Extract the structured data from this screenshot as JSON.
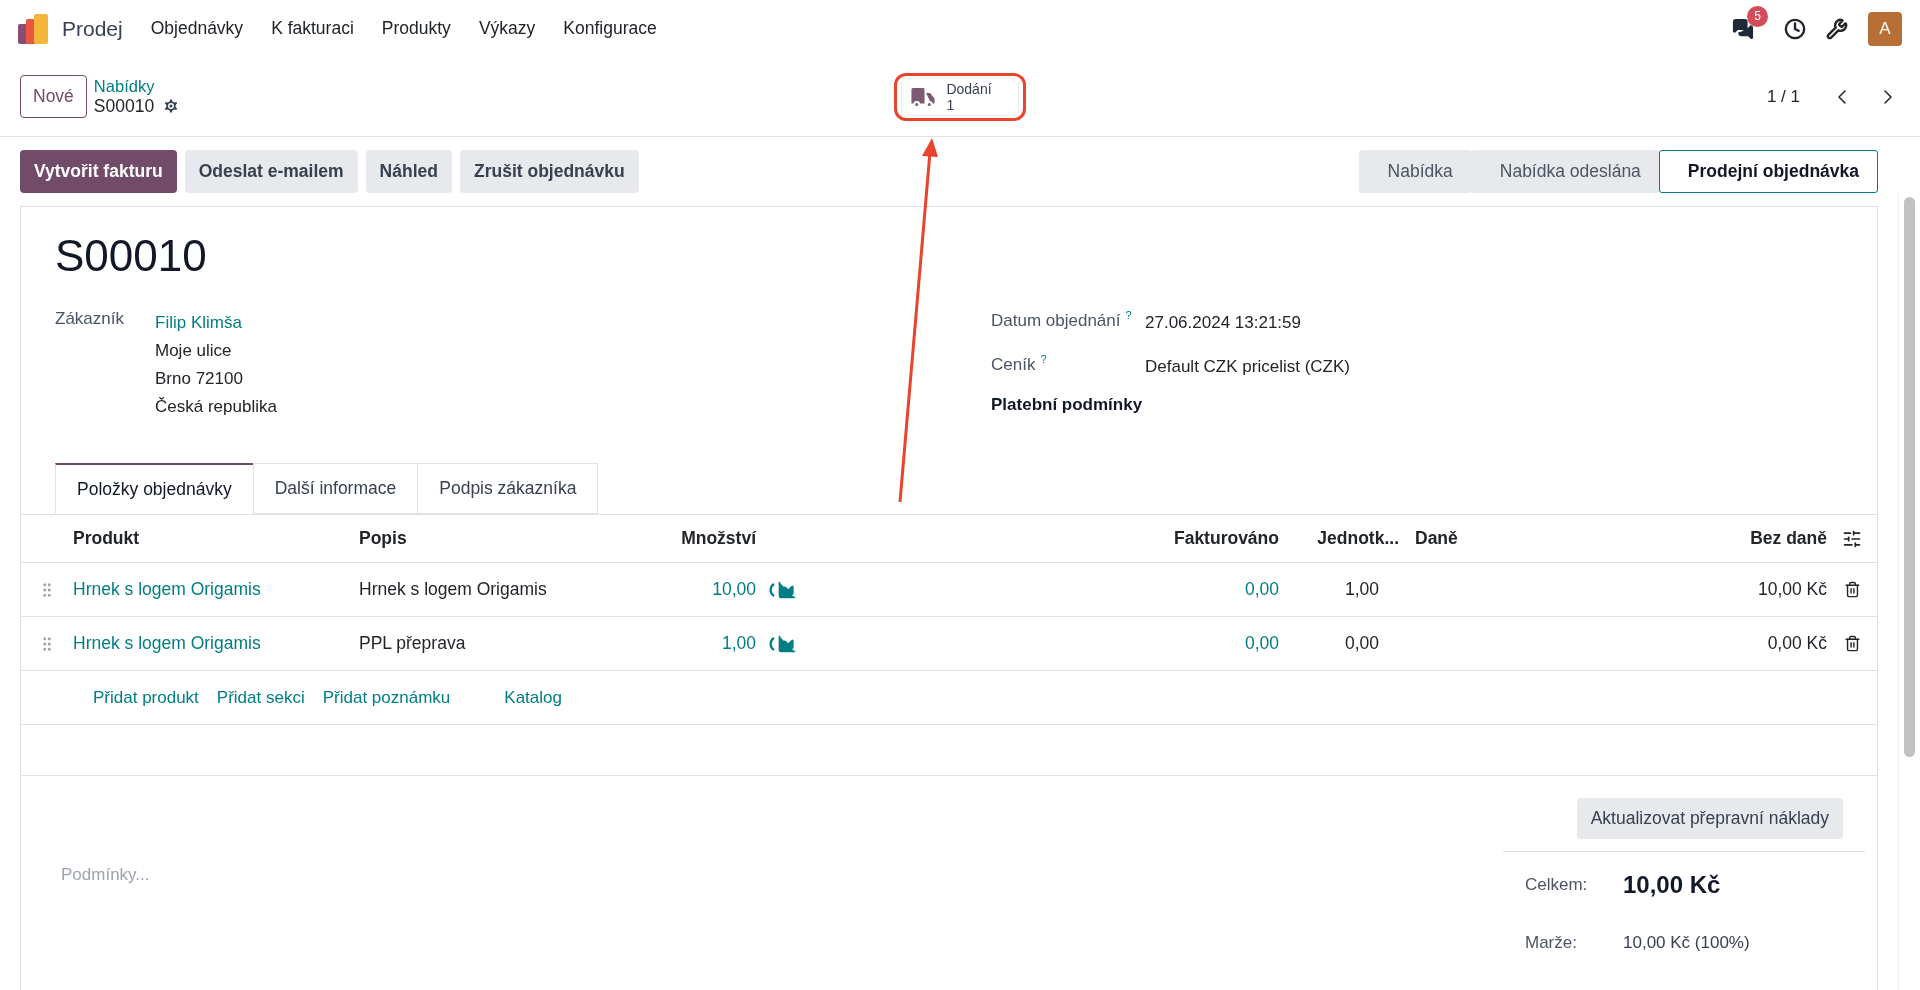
{
  "navbar": {
    "app": "Prodej",
    "menu": [
      "Objednávky",
      "K fakturaci",
      "Produkty",
      "Výkazy",
      "Konfigurace"
    ],
    "chat_badge": "5",
    "avatar": "A"
  },
  "control_panel": {
    "new_button": "Nové",
    "breadcrumb": "Nabídky",
    "record": "S00010",
    "smart_button": {
      "label": "Dodání",
      "count": "1",
      "highlighted": true
    },
    "pager": "1 / 1"
  },
  "actions": [
    {
      "label": "Vytvořit fakturu",
      "primary": true
    },
    {
      "label": "Odeslat e-mailem",
      "primary": false
    },
    {
      "label": "Náhled",
      "primary": false
    },
    {
      "label": "Zrušit objednávku",
      "primary": false
    }
  ],
  "statusbar": [
    {
      "label": "Nabídka",
      "selected": false
    },
    {
      "label": "Nabídka odeslána",
      "selected": false
    },
    {
      "label": "Prodejní objednávka",
      "selected": true
    }
  ],
  "sheet": {
    "title": "S00010",
    "customer": {
      "label": "Zákazník",
      "name": "Filip Klimša",
      "address": [
        "Moje ulice",
        "Brno 72100",
        "Česká republika"
      ]
    },
    "fields": [
      {
        "label": "Datum objednání",
        "help": "?",
        "value": "27.06.2024 13:21:59",
        "required": false
      },
      {
        "label": "Ceník",
        "help": "?",
        "value": "Default CZK pricelist (CZK)",
        "required": false
      },
      {
        "label": "Platební podmínky",
        "required": true
      }
    ],
    "tabs": [
      {
        "label": "Položky objednávky",
        "selected": true
      },
      {
        "label": "Další informace",
        "selected": false
      },
      {
        "label": "Podpis zákazníka",
        "selected": false
      }
    ],
    "table": {
      "columns": [
        "Produkt",
        "Popis",
        "Množství",
        "Fakturováno",
        "Jednotk...",
        "Daně",
        "Bez daně"
      ],
      "rows": [
        {
          "product": "Hrnek s logem Origamis",
          "description": "Hrnek s logem Origamis",
          "quantity": "10,00",
          "invoiced": "0,00",
          "unit_price": "1,00",
          "subtotal": "10,00 Kč"
        },
        {
          "product": "Hrnek s logem Origamis",
          "description": "PPL přeprava",
          "quantity": "1,00",
          "invoiced": "0,00",
          "unit_price": "0,00",
          "subtotal": "0,00 Kč"
        }
      ],
      "add_links": [
        "Přidat produkt",
        "Přidat sekci",
        "Přidat poznámku",
        "Katalog"
      ]
    },
    "terms": {
      "placeholder": "Podmínky..."
    },
    "update_button": "Aktualizovat přepravní náklady",
    "totals": [
      {
        "kind": "total",
        "label": "Celkem:",
        "value": "10,00 Kč"
      },
      {
        "kind": "margin",
        "label": "Marže:",
        "value": "10,00 Kč (100%)"
      }
    ]
  }
}
